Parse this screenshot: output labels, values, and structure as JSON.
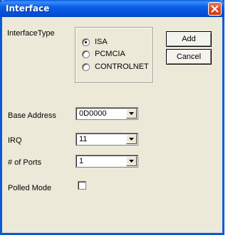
{
  "window": {
    "title": "Interface"
  },
  "interface_type": {
    "label": "InterfaceType",
    "options": [
      "ISA",
      "PCMCIA",
      "CONTROLNET"
    ],
    "selected": "ISA"
  },
  "buttons": {
    "add": "Add",
    "cancel": "Cancel"
  },
  "base_address": {
    "label": "Base Address",
    "value": "0D0000"
  },
  "irq": {
    "label": "IRQ",
    "value": "11"
  },
  "ports": {
    "label": "# of Ports",
    "value": "1"
  },
  "polled_mode": {
    "label": "Polled Mode",
    "checked": false
  },
  "icons": {
    "close": "close-icon",
    "dropdown": "chevron-down-icon"
  }
}
